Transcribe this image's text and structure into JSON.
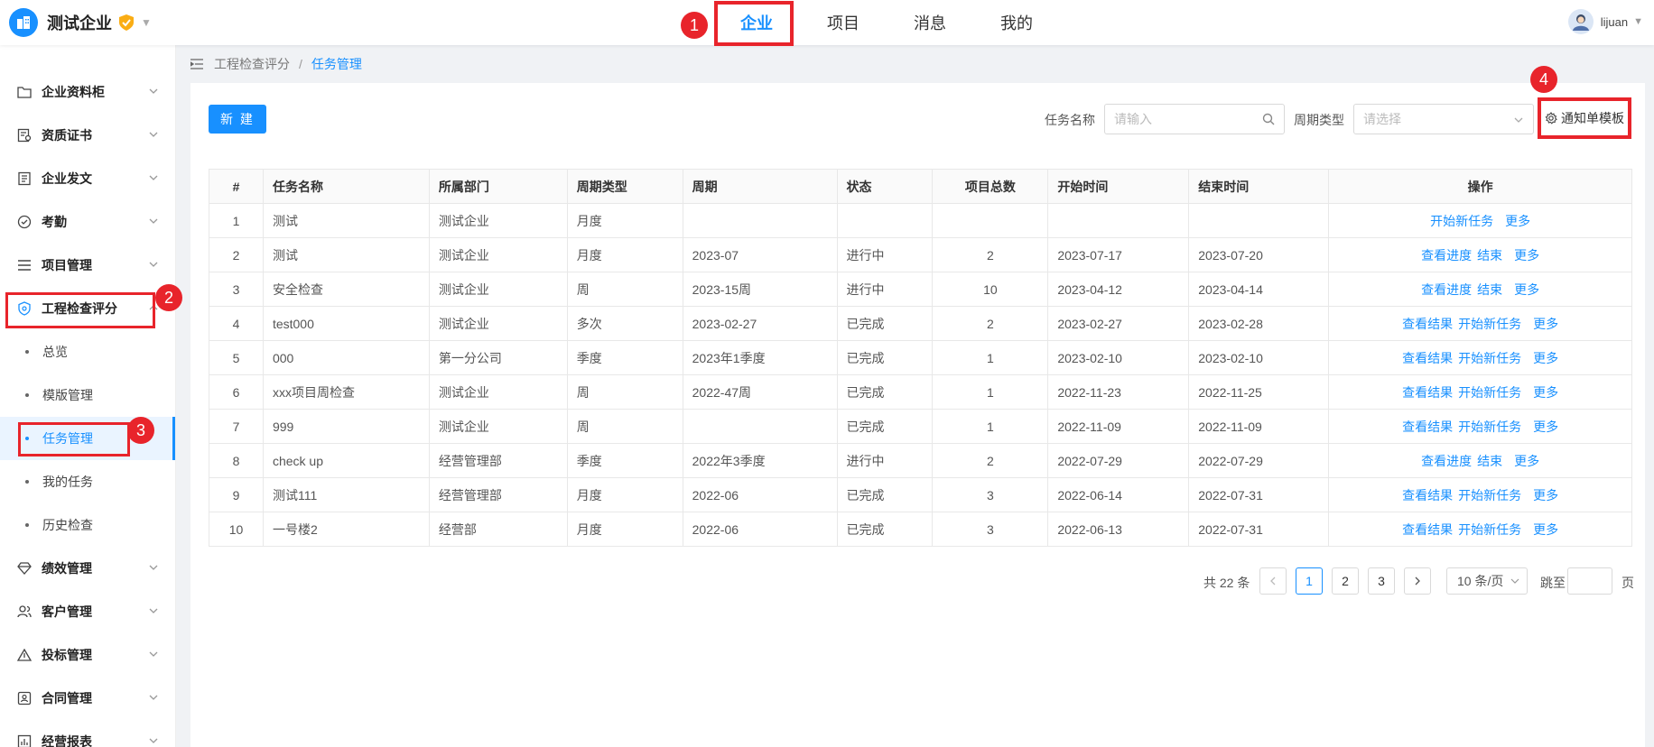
{
  "header": {
    "brand_name": "测试企业",
    "nav": [
      {
        "label": "企业",
        "active": true
      },
      {
        "label": "项目",
        "active": false
      },
      {
        "label": "消息",
        "active": false
      },
      {
        "label": "我的",
        "active": false
      }
    ],
    "username": "lijuan"
  },
  "badges": [
    "1",
    "2",
    "3",
    "4"
  ],
  "sidebar": {
    "items": [
      {
        "label": "企业资料柜",
        "icon": "folder-icon"
      },
      {
        "label": "资质证书",
        "icon": "certificate-icon"
      },
      {
        "label": "企业发文",
        "icon": "document-icon"
      },
      {
        "label": "考勤",
        "icon": "check-circle-icon"
      },
      {
        "label": "项目管理",
        "icon": "list-icon"
      },
      {
        "label": "工程检查评分",
        "icon": "shield-icon"
      }
    ],
    "sub_items": [
      "总览",
      "模版管理",
      "任务管理",
      "我的任务",
      "历史检查"
    ],
    "bottom_items": [
      {
        "label": "绩效管理",
        "icon": "diamond-icon"
      },
      {
        "label": "客户管理",
        "icon": "users-icon"
      },
      {
        "label": "投标管理",
        "icon": "triangle-icon"
      },
      {
        "label": "合同管理",
        "icon": "contract-icon"
      },
      {
        "label": "经营报表",
        "icon": "chart-icon"
      }
    ]
  },
  "breadcrumb": {
    "parent": "工程检查评分",
    "separator": "/",
    "current": "任务管理"
  },
  "toolbar": {
    "new_label": "新 建",
    "task_name_label": "任务名称",
    "task_name_placeholder": "请输入",
    "cycle_type_label": "周期类型",
    "cycle_type_placeholder": "请选择",
    "template_label": "通知单模板"
  },
  "table": {
    "columns": [
      "#",
      "任务名称",
      "所属部门",
      "周期类型",
      "周期",
      "状态",
      "项目总数",
      "开始时间",
      "结束时间",
      "操作"
    ],
    "rows": [
      {
        "no": "1",
        "name": "测试",
        "dept": "测试企业",
        "cycle_type": "月度",
        "cycle": "",
        "status": "",
        "total": "",
        "start": "",
        "end": "",
        "ops": [
          "开始新任务"
        ]
      },
      {
        "no": "2",
        "name": "测试",
        "dept": "测试企业",
        "cycle_type": "月度",
        "cycle": "2023-07",
        "status": "进行中",
        "total": "2",
        "start": "2023-07-17",
        "end": "2023-07-20",
        "ops": [
          "查看进度",
          "结束"
        ]
      },
      {
        "no": "3",
        "name": "安全检查",
        "dept": "测试企业",
        "cycle_type": "周",
        "cycle": "2023-15周",
        "status": "进行中",
        "total": "10",
        "start": "2023-04-12",
        "end": "2023-04-14",
        "ops": [
          "查看进度",
          "结束"
        ]
      },
      {
        "no": "4",
        "name": "test000",
        "dept": "测试企业",
        "cycle_type": "多次",
        "cycle": "2023-02-27",
        "status": "已完成",
        "total": "2",
        "start": "2023-02-27",
        "end": "2023-02-28",
        "ops": [
          "查看结果",
          "开始新任务"
        ]
      },
      {
        "no": "5",
        "name": "000",
        "dept": "第一分公司",
        "cycle_type": "季度",
        "cycle": "2023年1季度",
        "status": "已完成",
        "total": "1",
        "start": "2023-02-10",
        "end": "2023-02-10",
        "ops": [
          "查看结果",
          "开始新任务"
        ]
      },
      {
        "no": "6",
        "name": "xxx项目周检查",
        "dept": "测试企业",
        "cycle_type": "周",
        "cycle": "2022-47周",
        "status": "已完成",
        "total": "1",
        "start": "2022-11-23",
        "end": "2022-11-25",
        "ops": [
          "查看结果",
          "开始新任务"
        ]
      },
      {
        "no": "7",
        "name": "999",
        "dept": "测试企业",
        "cycle_type": "周",
        "cycle": "",
        "status": "已完成",
        "total": "1",
        "start": "2022-11-09",
        "end": "2022-11-09",
        "ops": [
          "查看结果",
          "开始新任务"
        ]
      },
      {
        "no": "8",
        "name": "check up",
        "dept": "经营管理部",
        "cycle_type": "季度",
        "cycle": "2022年3季度",
        "status": "进行中",
        "total": "2",
        "start": "2022-07-29",
        "end": "2022-07-29",
        "ops": [
          "查看进度",
          "结束"
        ]
      },
      {
        "no": "9",
        "name": "测试111",
        "dept": "经营管理部",
        "cycle_type": "月度",
        "cycle": "2022-06",
        "status": "已完成",
        "total": "3",
        "start": "2022-06-14",
        "end": "2022-07-31",
        "ops": [
          "查看结果",
          "开始新任务"
        ]
      },
      {
        "no": "10",
        "name": "一号楼2",
        "dept": "经营部",
        "cycle_type": "月度",
        "cycle": "2022-06",
        "status": "已完成",
        "total": "3",
        "start": "2022-06-13",
        "end": "2022-07-31",
        "ops": [
          "查看结果",
          "开始新任务"
        ]
      }
    ],
    "more_label": "更多"
  },
  "pagination": {
    "total_text": "共 22 条",
    "pages": [
      "1",
      "2",
      "3"
    ],
    "current_page": "1",
    "page_size": "10 条/页",
    "jump_label": "跳至",
    "page_unit": "页"
  },
  "colors": {
    "primary": "#1890ff",
    "highlight": "#e8242b"
  }
}
